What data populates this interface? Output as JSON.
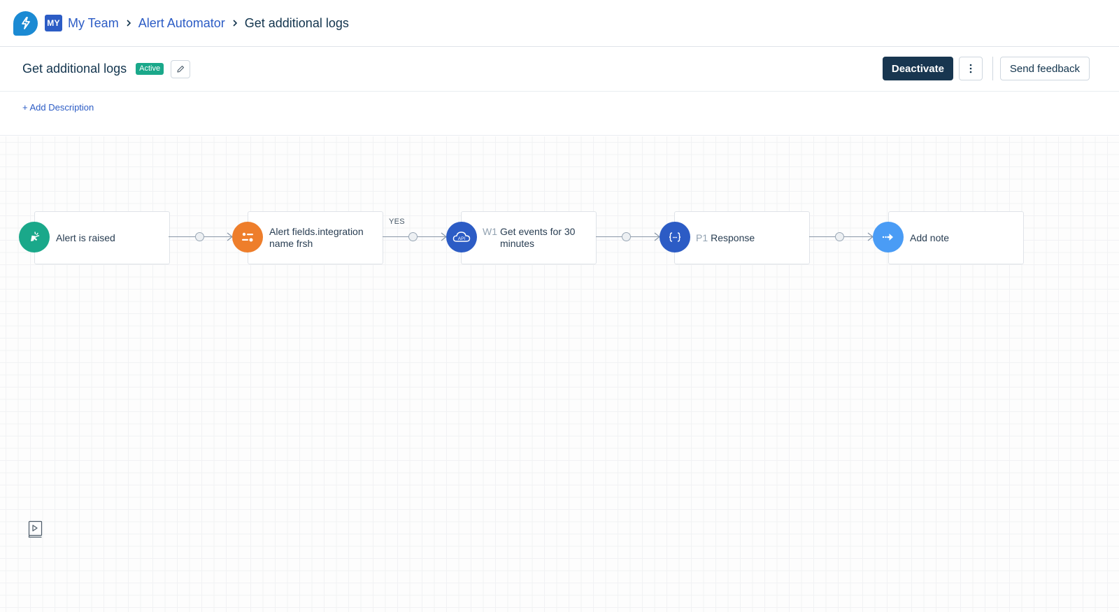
{
  "topbar": {
    "app_logo_icon": "lightning-bolt-icon",
    "team_badge": "MY",
    "breadcrumb": [
      {
        "label": "My Team",
        "link": true
      },
      {
        "label": "Alert Automator",
        "link": true
      },
      {
        "label": "Get additional logs",
        "link": false
      }
    ]
  },
  "header": {
    "title": "Get additional logs",
    "status": "Active",
    "edit_icon": "pencil-icon",
    "deactivate_label": "Deactivate",
    "more_icon": "vertical-ellipsis-icon",
    "feedback_label": "Send feedback"
  },
  "description": {
    "add_label": "+ Add Description"
  },
  "workflow": {
    "nodes": [
      {
        "prefix": "",
        "label": "Alert is raised",
        "icon": "cursor-click-icon",
        "color": "#1aa88a"
      },
      {
        "prefix": "",
        "label": "Alert fields.integration name frsh",
        "icon": "condition-toggle-icon",
        "color": "#ee7e2b"
      },
      {
        "prefix": "W1",
        "label": "Get events for 30 minutes",
        "icon": "api-cloud-icon",
        "color": "#2c5cc5"
      },
      {
        "prefix": "P1",
        "label": "Response",
        "icon": "json-braces-icon",
        "color": "#2c5cc5"
      },
      {
        "prefix": "",
        "label": "Add note",
        "icon": "arrow-right-icon",
        "color": "#4a9cf5"
      }
    ],
    "connectors": [
      {
        "label": ""
      },
      {
        "label": "YES"
      },
      {
        "label": ""
      },
      {
        "label": ""
      }
    ]
  },
  "canvas": {
    "minimap_icon": "play-book-icon"
  }
}
